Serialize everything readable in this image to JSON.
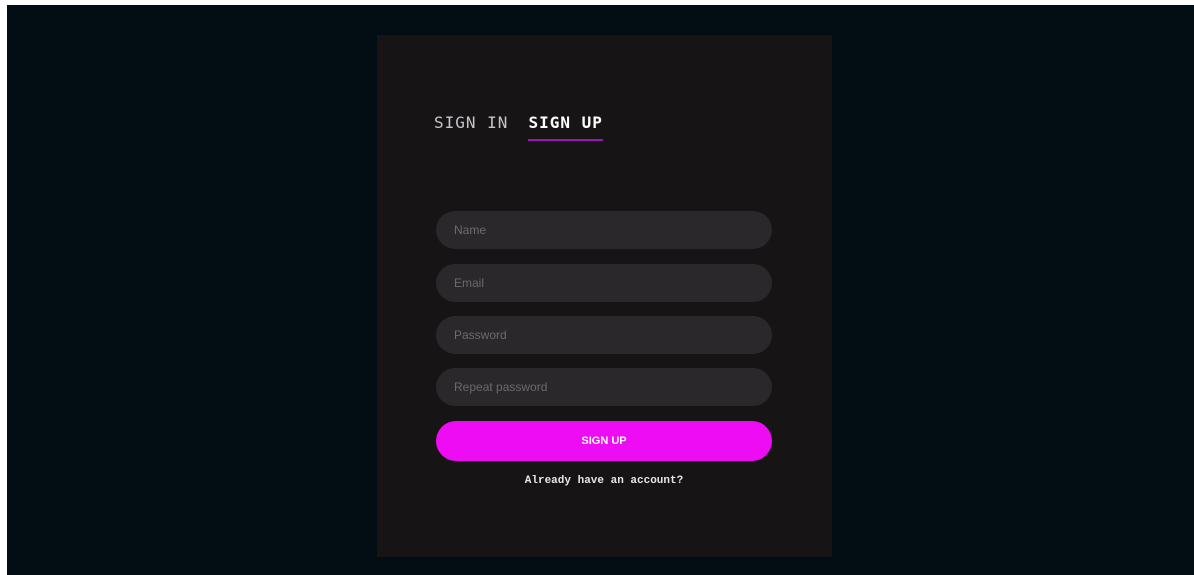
{
  "tabs": {
    "sign_in": "SIGN IN",
    "sign_up": "SIGN UP",
    "active": "sign_up"
  },
  "form": {
    "name": {
      "value": "",
      "placeholder": "Name"
    },
    "email": {
      "value": "",
      "placeholder": "Email"
    },
    "password": {
      "value": "",
      "placeholder": "Password"
    },
    "repeat_password": {
      "value": "",
      "placeholder": "Repeat password"
    }
  },
  "submit_label": "SIGN UP",
  "account_link": "Already have an account?",
  "colors": {
    "background": "#030d14",
    "card": "#171416",
    "input": "#2a282b",
    "accent": "#ee0cf4",
    "tab_underline": "#9c14b4"
  }
}
